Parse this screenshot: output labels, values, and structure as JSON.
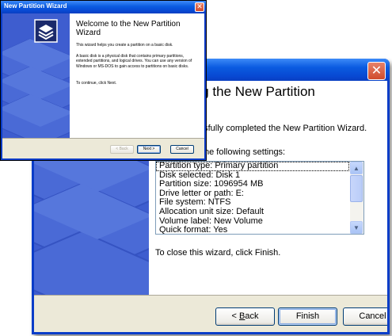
{
  "back_window": {
    "heading": "ing the New Partition",
    "line_completed": "cessfully completed the New Partition Wizard.",
    "line_settings": "he following settings:",
    "settings": [
      "Partition type: Primary partition",
      "Disk selected: Disk 1",
      "Partition size: 1096954 MB",
      "Drive letter or path: E:",
      "File system: NTFS",
      "Allocation unit size: Default",
      "Volume label: New Volume",
      "Quick format: Yes"
    ],
    "finish_note": "To close this wizard, click Finish.",
    "buttons": {
      "back_prefix": "< ",
      "back_key": "B",
      "back_rest": "ack",
      "finish": "Finish",
      "cancel": "Cancel"
    },
    "close_glyph": "✕"
  },
  "front_window": {
    "title": "New Partition Wizard",
    "heading": "Welcome to the New Partition Wizard",
    "p1": "This wizard helps you create a partition on a basic disk.",
    "p2": "A basic disk is a physical disk that contains primary partitions, extended partitions, and logical drives. You can use any version of Windows or MS-DOS to gain access to partitions on basic disks.",
    "p3": "To continue, click Next.",
    "buttons": {
      "back": "< Back",
      "next": "Next >",
      "cancel": "Cancel"
    },
    "close_glyph": "✕"
  },
  "colors": {
    "titlebar": "#0a5be0",
    "sidebar": "#3e5dcf",
    "dialog_face": "#ece9d8",
    "close": "#d14b2b"
  }
}
